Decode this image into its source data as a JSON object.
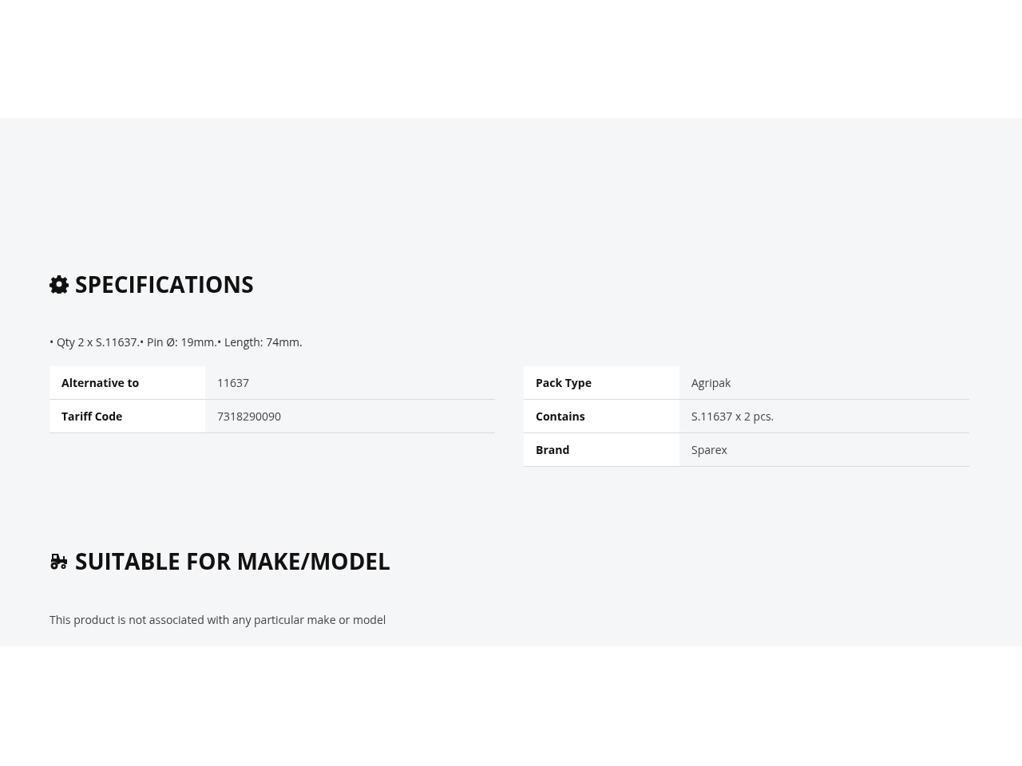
{
  "specifications": {
    "heading": "SPECIFICATIONS",
    "description": "• Qty 2 x S.11637.• Pin Ø: 19mm.• Length: 74mm.",
    "tables": [
      [
        {
          "label": "Alternative to",
          "value": "11637"
        },
        {
          "label": "Tariff Code",
          "value": "7318290090"
        }
      ],
      [
        {
          "label": "Pack Type",
          "value": "Agripak"
        },
        {
          "label": "Contains",
          "value": "S.11637 x 2 pcs."
        },
        {
          "label": "Brand",
          "value": "Sparex"
        }
      ]
    ]
  },
  "suitable": {
    "heading": "SUITABLE FOR MAKE/MODEL",
    "text": "This product is not associated with any particular make or model"
  }
}
